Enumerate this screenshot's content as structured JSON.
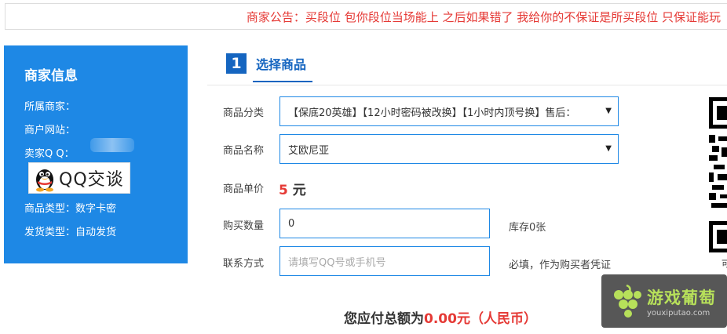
{
  "notice": {
    "text": "商家公告：买段位 包你段位当场能上 之后如果错了 我给你的不保证是所买段位 只保证能玩"
  },
  "merchant": {
    "title": "商家信息",
    "owner_label": "所属商家：",
    "website_label": "商户网站：",
    "qq_label": "卖家Q Q：",
    "qq_button_label": "QQ交谈",
    "product_type": "商品类型：数字卡密",
    "delivery_type": "发货类型：自动发货"
  },
  "step": {
    "number": "1",
    "title": "选择商品"
  },
  "form": {
    "category_label": "商品分类",
    "category_value": "【保底20英雄】【12小时密码被改换】【1小时内顶号换】售后：",
    "name_label": "商品名称",
    "name_value": "艾欧尼亚",
    "price_label": "商品单价",
    "price_value": "5",
    "price_unit": "元",
    "quantity_label": "购买数量",
    "quantity_value": "0",
    "stock_text": "库存0张",
    "contact_label": "联系方式",
    "contact_placeholder": "请填写QQ号或手机号",
    "contact_hint": "必填，作为购买者凭证"
  },
  "total": {
    "prefix": "您应付总额为",
    "amount": "0.00",
    "suffix": "元（人民币）"
  },
  "qr": {
    "caption": "可"
  },
  "watermark": {
    "cn": "游戏葡萄",
    "en": "youxiputao.com"
  },
  "colors": {
    "accent_blue": "#1e88e5",
    "panel_blue": "#1e88e5",
    "step_blue": "#1565c0",
    "alert_red": "#e53935"
  }
}
